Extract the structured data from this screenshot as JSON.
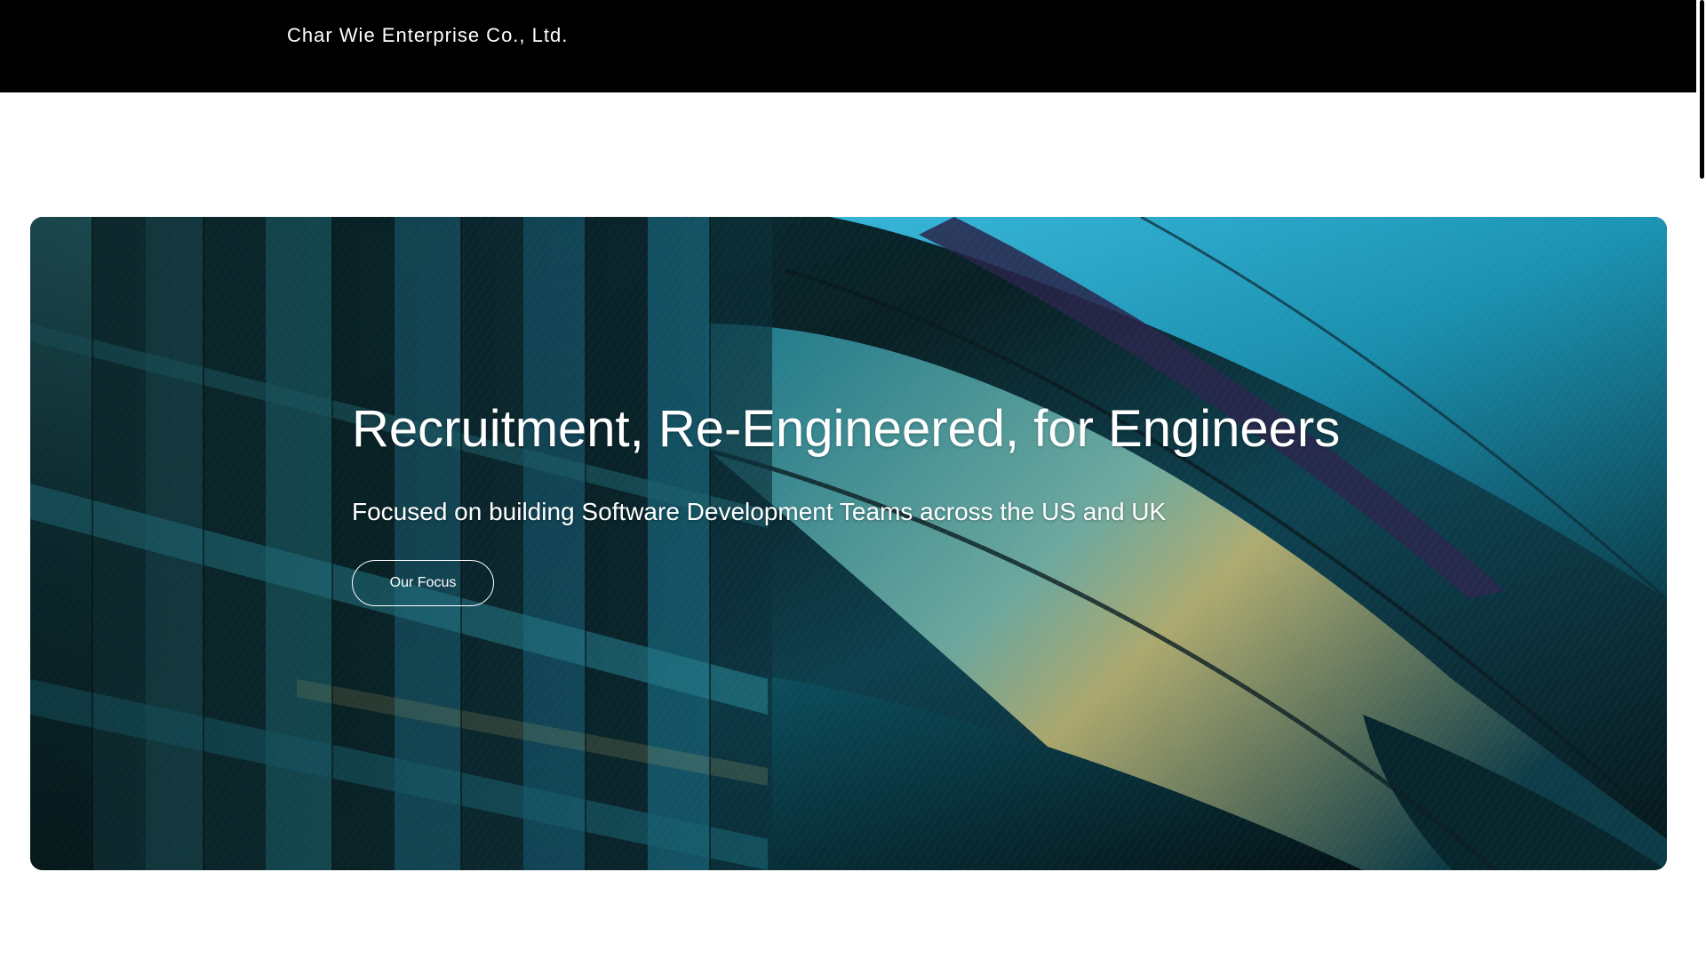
{
  "header": {
    "brand": "Char Wie Enterprise Co., Ltd."
  },
  "hero": {
    "title": "Recruitment, Re-Engineered, for Engineers",
    "subtitle": "Focused on building Software Development Teams across the US and UK",
    "cta_label": "Our Focus"
  },
  "colors": {
    "header_bg": "#000000",
    "page_bg": "#ffffff",
    "hero_text": "#ffffff",
    "feather_dark": "#0a2a30",
    "feather_teal": "#1f8fa6",
    "feather_cyan": "#3cc8ef",
    "feather_gold": "#c9c07a"
  }
}
